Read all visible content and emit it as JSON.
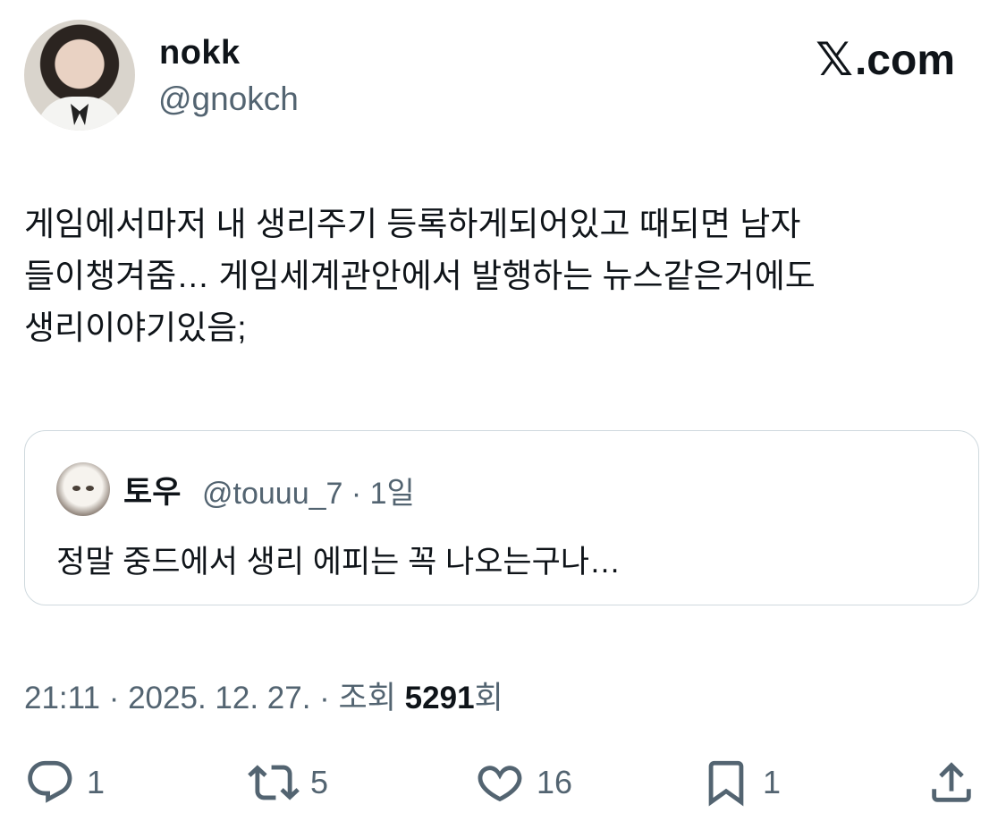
{
  "author": {
    "name": "nokk",
    "handle": "@gnokch"
  },
  "brand": {
    "x_glyph": "𝕏",
    "domain": ".com"
  },
  "tweet": {
    "text": "게임에서마저 내 생리주기 등록하게되어있고 때되면 남자\n들이챙겨줌… 게임세계관안에서 발행하는 뉴스같은거에도\n생리이야기있음;"
  },
  "quote": {
    "name": "토우",
    "meta": "@touuu_7 · 1일",
    "text": "정말 중드에서 생리 에피는 꼭 나오는구나…"
  },
  "meta": {
    "time_date": "21:11 · 2025. 12. 27. · 조회 ",
    "views": "5291",
    "views_suffix": "회"
  },
  "actions": {
    "replies": "1",
    "reposts": "5",
    "likes": "16",
    "bookmarks": "1"
  }
}
